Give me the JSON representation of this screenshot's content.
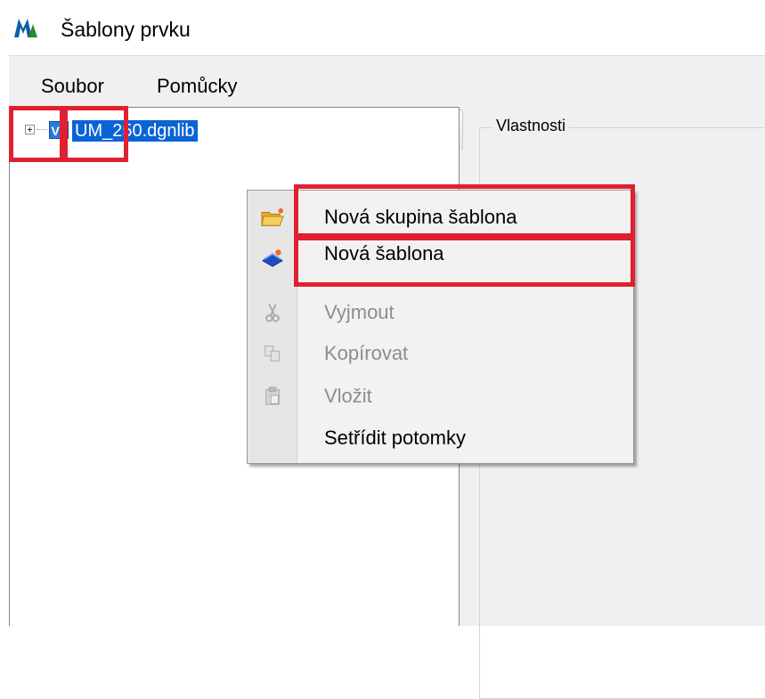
{
  "window": {
    "title": "Šablony prvku"
  },
  "menubar": {
    "items": [
      {
        "label": "Soubor"
      },
      {
        "label": "Pomůcky"
      }
    ]
  },
  "tree": {
    "root": {
      "badge": "V8",
      "label": "UM_250.dgnlib",
      "selected": true
    }
  },
  "properties": {
    "title": "Vlastnosti"
  },
  "context_menu": {
    "items": [
      {
        "label": "Nová skupina šablona",
        "icon": "new-group-folder-icon",
        "enabled": true
      },
      {
        "label": "Nová šablona",
        "icon": "new-template-icon",
        "enabled": true
      },
      {
        "label": "Vyjmout",
        "icon": "cut-icon",
        "enabled": false
      },
      {
        "label": "Kopírovat",
        "icon": "copy-icon",
        "enabled": false
      },
      {
        "label": "Vložit",
        "icon": "paste-icon",
        "enabled": false
      },
      {
        "label": "Setřídit potomky",
        "icon": "sort-icon",
        "enabled": true
      }
    ]
  },
  "toolbar": {
    "buttons": [
      {
        "icon": "new-group-folder-icon",
        "enabled": true
      },
      {
        "icon": "new-template-icon",
        "enabled": true
      },
      {
        "icon": "cut-icon",
        "enabled": false
      },
      {
        "icon": "copy-icon",
        "enabled": false
      },
      {
        "icon": "paste-icon",
        "enabled": false
      },
      {
        "icon": "move-up-icon",
        "enabled": false
      },
      {
        "icon": "move-down-icon",
        "enabled": false
      },
      {
        "icon": "delete-icon",
        "enabled": false
      }
    ]
  },
  "colors": {
    "highlight": "#e02030",
    "selection": "#0a64d6"
  }
}
